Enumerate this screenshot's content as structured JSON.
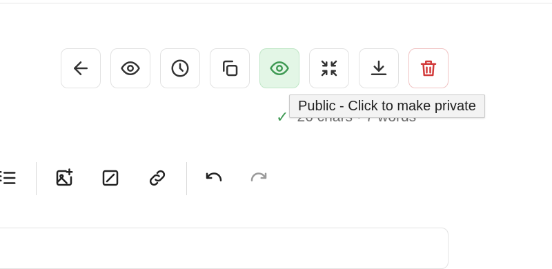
{
  "toolbar": {
    "buttons": [
      {
        "id": "back",
        "icon": "arrow-left-icon"
      },
      {
        "id": "preview",
        "icon": "eye-icon"
      },
      {
        "id": "history",
        "icon": "clock-icon"
      },
      {
        "id": "copy",
        "icon": "copy-icon"
      },
      {
        "id": "visibility",
        "icon": "eye-icon",
        "state": "public",
        "color": "#3f9a54"
      },
      {
        "id": "collapse",
        "icon": "minimize-icon"
      },
      {
        "id": "download",
        "icon": "download-icon"
      },
      {
        "id": "delete",
        "icon": "trash-icon",
        "color": "#d23a3a"
      }
    ]
  },
  "tooltip": {
    "text": "Public - Click to make private"
  },
  "status": {
    "check": "✓",
    "stats": "26 chars · 7 words"
  },
  "format_toolbar": {
    "buttons": [
      {
        "id": "list",
        "icon": "list-icon"
      },
      {
        "id": "insert-image",
        "icon": "image-plus-icon"
      },
      {
        "id": "embed",
        "icon": "square-slash-icon"
      },
      {
        "id": "link",
        "icon": "link-icon"
      },
      {
        "id": "undo",
        "icon": "undo-icon"
      },
      {
        "id": "redo",
        "icon": "redo-icon",
        "disabled": true
      }
    ]
  },
  "colors": {
    "accent_green": "#3f9a54",
    "danger": "#d23a3a",
    "icon": "#333333",
    "muted": "#9a9a9a"
  }
}
